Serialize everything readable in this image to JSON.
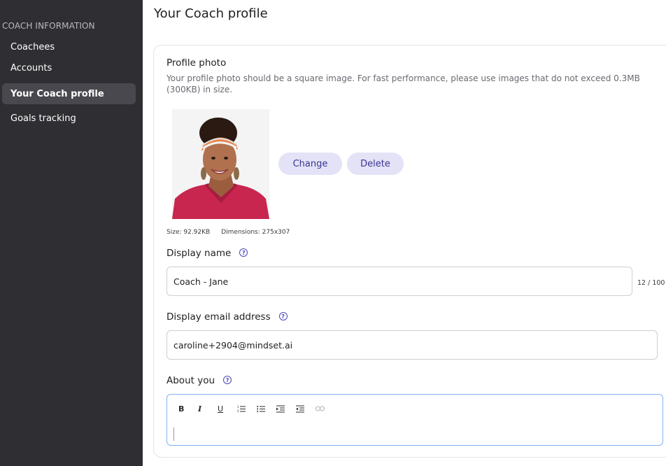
{
  "sidebar": {
    "heading": "COACH INFORMATION",
    "items": [
      {
        "label": "Coachees"
      },
      {
        "label": "Accounts"
      },
      {
        "label": "Your Coach profile",
        "active": true
      },
      {
        "label": "Goals tracking"
      }
    ]
  },
  "page": {
    "title": "Your Coach profile"
  },
  "profile_photo": {
    "label": "Profile photo",
    "help": "Your profile photo should be a square image. For fast performance, please use images that do not exceed 0.3MB (300KB) in size.",
    "change_label": "Change",
    "delete_label": "Delete",
    "size": "Size: 92.92KB",
    "dimensions": "Dimensions: 275x307"
  },
  "display_name": {
    "label": "Display name",
    "value": "Coach - Jane",
    "counter": "12 / 100"
  },
  "display_email": {
    "label": "Display email address",
    "value": "caroline+2904@mindset.ai"
  },
  "about": {
    "label": "About you",
    "toolbar": [
      "bold-icon",
      "italic-icon",
      "underline-icon",
      "ordered-list-icon",
      "bullet-list-icon",
      "indent-icon",
      "outdent-icon",
      "link-icon"
    ],
    "bold": "B",
    "italic": "I",
    "underline": "U"
  },
  "help_glyph": "?",
  "colors": {
    "sidebar_bg": "#2f2f33",
    "active_item_bg": "#48484e",
    "pill_bg": "#e4e2f6",
    "pill_text": "#3a3590",
    "accent": "#4b46b8",
    "focus_border": "#7fb3ee"
  }
}
